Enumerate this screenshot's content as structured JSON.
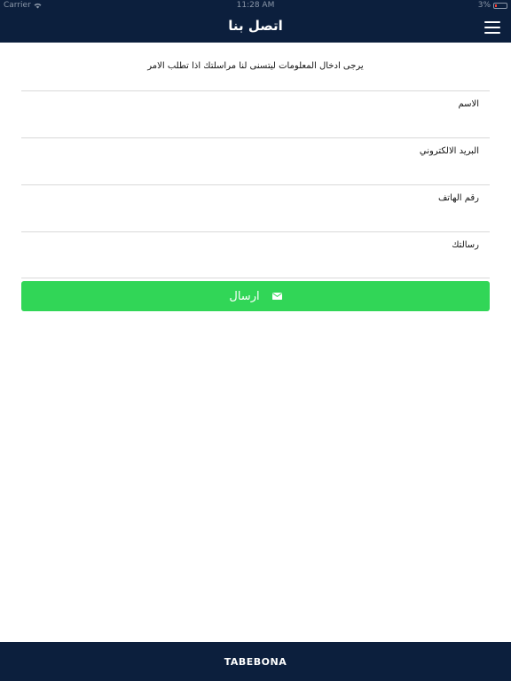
{
  "status_bar": {
    "carrier": "Carrier",
    "time": "11:28 AM",
    "battery": "3%"
  },
  "header": {
    "title": "اتصل بنا",
    "menu_icon": "hamburger-menu-icon"
  },
  "form": {
    "intro": "يرجى ادخال المعلومات ليتسنى لنا مراسلتك اذا تطلب الامر",
    "fields": [
      {
        "label": "الاسم",
        "value": ""
      },
      {
        "label": "البريد الالكتروني",
        "value": ""
      },
      {
        "label": "رقم الهاتف",
        "value": ""
      },
      {
        "label": "رسالتك",
        "value": ""
      }
    ],
    "send_label": "ارسال",
    "send_icon": "envelope-icon"
  },
  "footer": {
    "brand": "TABEBONA"
  },
  "colors": {
    "navbar": "#0c1f3d",
    "send_button": "#31d657"
  }
}
